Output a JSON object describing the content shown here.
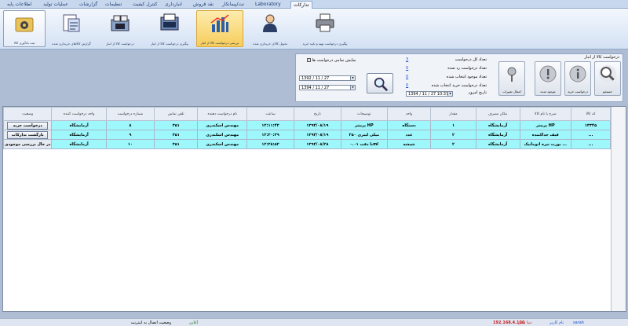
{
  "tabs": [
    {
      "label": "اطلاعات پایه",
      "active": false
    },
    {
      "label": "عملیات تولید",
      "active": false
    },
    {
      "label": "گزارشات",
      "active": false
    },
    {
      "label": "تنظیمات",
      "active": false
    },
    {
      "label": "کنترل کیفیت",
      "active": false
    },
    {
      "label": "انبارداری",
      "active": false
    },
    {
      "label": "نقد فروش",
      "active": false
    },
    {
      "label": "نت/پیمانکار",
      "active": false
    },
    {
      "label": "Laboratory",
      "active": false
    },
    {
      "label": "تدارکات",
      "active": true
    }
  ],
  "ribbon": [
    {
      "label": "ثبت یادآوری کالا",
      "icon": "gear-folder-icon",
      "state": "outline"
    },
    {
      "label": "گزارش کالاهای خریداری شده",
      "icon": "report-icon",
      "state": "normal"
    },
    {
      "label": "درخواست کالا از انبار",
      "icon": "warehouse-icon",
      "state": "normal"
    },
    {
      "label": "پیگیری درخواست کالا از انبار",
      "icon": "tracking-icon",
      "state": "normal"
    },
    {
      "label": "بررسی درخواست کالا از انبار",
      "icon": "chart-icon",
      "state": "selected"
    },
    {
      "label": "تحویل کالای خریداری شده",
      "icon": "person-icon",
      "state": "normal"
    },
    {
      "label": "پیگیری درخواست تهیه و تایید خرید",
      "icon": "printer-icon",
      "state": "normal"
    }
  ],
  "panel": {
    "title": "درخواست کالا از انبار",
    "buttons": [
      {
        "label": "جستجو",
        "icon": "search-icon"
      },
      {
        "label": "درخواست خرید",
        "icon": "info-icon"
      },
      {
        "label": "موجود شده",
        "icon": "alert-icon"
      },
      {
        "label": "اعمال تغییرات",
        "icon": "pin-icon"
      }
    ],
    "stats": [
      {
        "label": "تعداد کل درخواست",
        "count": "3"
      },
      {
        "label": "تعداد درخواست رد شده",
        "count": "0"
      },
      {
        "label": "تعداد موجود انتخاب شده",
        "count": "0"
      },
      {
        "label": "تعداد درخواست خرید انتخاب شده",
        "count": "0"
      }
    ],
    "today_label": "تاریخ امروز",
    "today_value": "1394 / 11 / 27   10:37",
    "show_all_label": "نمایش تمامی درخواست ها",
    "date_from": "1392 / 11 / 27",
    "date_to": "1394 / 11 / 27"
  },
  "table": {
    "headers": [
      "کد کالا",
      "شرح یا نام کالا",
      "مکان مصرف",
      "مقدار",
      "واحد",
      "توضیحات",
      "تاریخ",
      "ساعت",
      "نام درخواست دهنده",
      "تلفن تماس",
      "شماره درخواست",
      "واحد درخواست کننده",
      "وضعیت"
    ],
    "rows": [
      {
        "cells": [
          "۱۳۳۴۵",
          "پرینتر HP",
          "آزمایشگاه",
          "۱",
          "دستگاه",
          "پرینتر HP",
          "۱۳۹۴/۰۸/۱۹",
          "۱۲:۱۱:۴۲",
          "مهندس اسکندری",
          "۳۵۱",
          "۸",
          "آزمایشگاه"
        ],
        "status": "درخواست خرید",
        "status_type": "button"
      },
      {
        "cells": [
          "...",
          "قیف جداکننده",
          "آزمایشگاه",
          "۲",
          "عدد",
          "۲۵۰ میلی لیتری",
          "۱۳۹۴/۰۸/۱۹",
          "۱۲:۲۰:۳۹",
          "مهندس اسکندری",
          "۳۵۱",
          "۹",
          "آزمایشگاه"
        ],
        "status": "بازگشت تدارکات",
        "status_type": "button"
      },
      {
        "cells": [
          "...",
          "بورت تیره اتوماتیک ...",
          "آزمایشگاه",
          "۲",
          "شیشه",
          "با دقت ۰.۰۱ml",
          "۱۳۹۴/۰۸/۲۸",
          "۱۲:۲۸:۵۲",
          "مهندس اسکندری",
          "۳۵۱",
          "۱۰",
          "آزمایشگاه"
        ],
        "status": "در حال بررسی موجودی",
        "status_type": "text"
      }
    ]
  },
  "statusbar": {
    "state_label": "وضعیت اتصال به اینترنت",
    "state_value": "آنلاین",
    "ip_label": "دیتا بیس",
    "ip_value": "192.168.4.100",
    "user_label": "نام کاربر",
    "user_value": "sarah"
  }
}
